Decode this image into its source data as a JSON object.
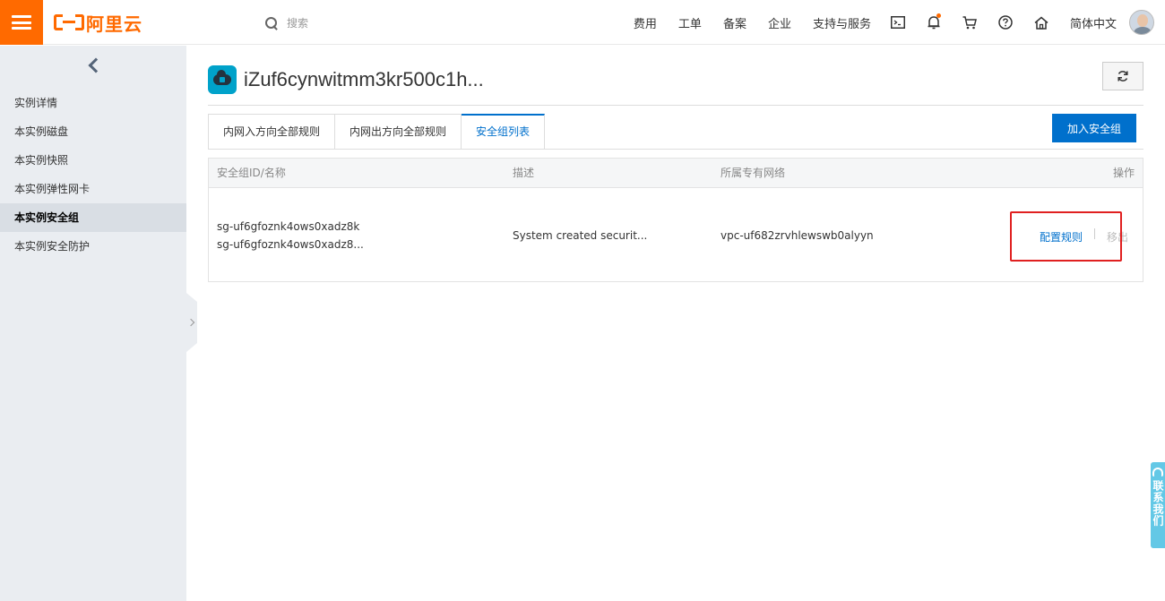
{
  "header": {
    "brand": "阿里云",
    "search_placeholder": "搜索",
    "nav_links": [
      "费用",
      "工单",
      "备案",
      "企业",
      "支持与服务"
    ],
    "language": "简体中文",
    "accent_color": "#ff6a00"
  },
  "sidebar": {
    "items": [
      {
        "label": "实例详情"
      },
      {
        "label": "本实例磁盘"
      },
      {
        "label": "本实例快照"
      },
      {
        "label": "本实例弹性网卡"
      },
      {
        "label": "本实例安全组",
        "active": true
      },
      {
        "label": "本实例安全防护"
      }
    ]
  },
  "main": {
    "title": "iZuf6cynwitmm3kr500c1h...",
    "tabs": [
      {
        "label": "内网入方向全部规则"
      },
      {
        "label": "内网出方向全部规则"
      },
      {
        "label": "安全组列表",
        "active": true
      }
    ],
    "join_button": "加入安全组",
    "table": {
      "columns": [
        "安全组ID/名称",
        "描述",
        "所属专有网络",
        "操作"
      ],
      "rows": [
        {
          "id": "sg-uf6gfoznk4ows0xadz8k",
          "name": "sg-uf6gfoznk4ows0xadz8...",
          "description": "System created securit...",
          "vpc": "vpc-uf682zrvhlewswb0alyyn",
          "actions": [
            "配置规则",
            "移出"
          ]
        }
      ]
    },
    "primary_color": "#0070cc"
  },
  "contact": {
    "label": "联系我们"
  }
}
